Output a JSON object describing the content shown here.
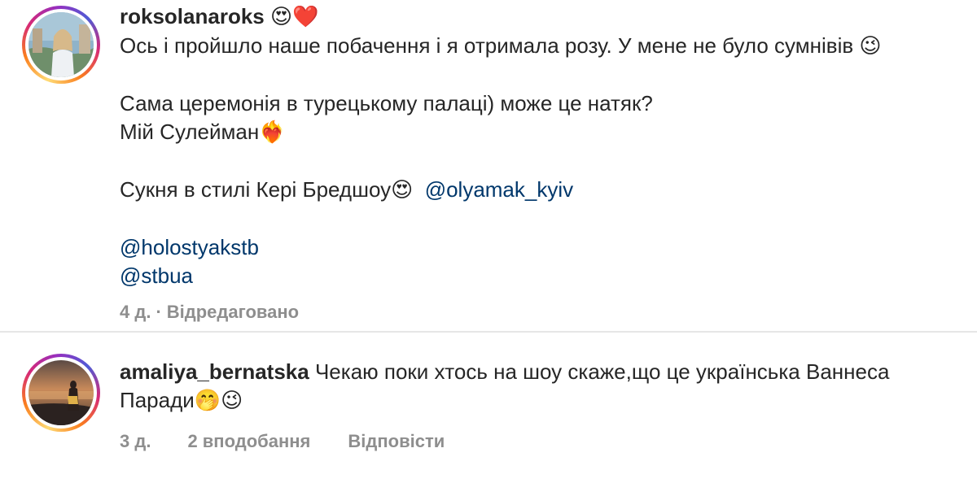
{
  "comments": [
    {
      "username": "roksolanaroks",
      "username_emoji": "😍❤️",
      "text_lines": [
        "Ось і пройшло наше побачення і я отримала розу. У мене не було сумнівів"
      ],
      "line1_emoji": "😉",
      "line3": "Сама церемонія в турецькому палаці) може це натяк?",
      "line4": "Мій Сулейман",
      "line4_emoji": "❤️‍🔥",
      "line6": "Сукня в стилі Кері Бредшоу",
      "line6_emoji": "😍",
      "mention1": "@olyamak_kyiv",
      "mention2": "@holostyakstb",
      "mention3": "@stbua",
      "time": "4 д.",
      "separator": "·",
      "edited": "Відредаговано"
    },
    {
      "username": "amaliya_bernatska",
      "text_line1": "Чекаю поки хтось на шоу скаже,що це українська Ваннеса",
      "text_line2": "Паради",
      "text_emoji": "🤭😉",
      "time": "3 д.",
      "likes": "2 вподобання",
      "reply": "Відповісти"
    }
  ],
  "colors": {
    "mention": "#00376b",
    "meta": "#8e8e8e",
    "text": "#262626",
    "divider": "#e6e6e6"
  },
  "icons": [
    "avatar-roksolanaroks",
    "avatar-amaliya-bernatska"
  ]
}
